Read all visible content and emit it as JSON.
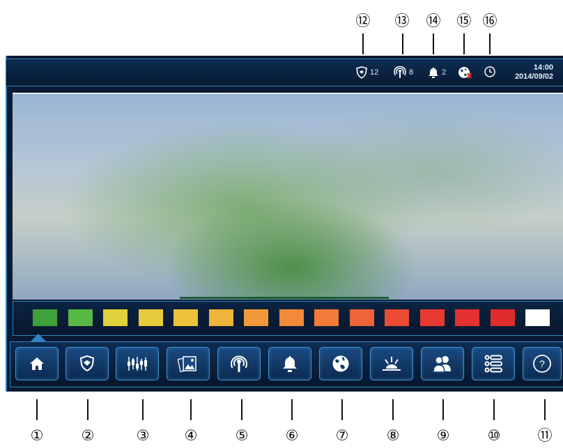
{
  "callouts_top": [
    "⑫",
    "⑬",
    "⑭",
    "⑮",
    "⑯"
  ],
  "callouts_bottom": [
    "①",
    "②",
    "③",
    "④",
    "⑤",
    "⑥",
    "⑦",
    "⑧",
    "⑨",
    "⑩",
    "⑪"
  ],
  "status": {
    "shield_count": "12",
    "antenna_count": "8",
    "bell_count": "2",
    "clock_time": "14:00",
    "clock_date": "2014/09/02"
  },
  "swatch_colors": [
    "#3fa13a",
    "#58b845",
    "#e0d23a",
    "#e6cc3c",
    "#ecc23a",
    "#efb43a",
    "#f29a3a",
    "#f28a3a",
    "#f27b3a",
    "#f0643a",
    "#ec4c36",
    "#e83a32",
    "#e33030",
    "#e02c2c",
    "#ffffff"
  ],
  "nav": [
    {
      "icon": "home-icon"
    },
    {
      "icon": "shield-icon"
    },
    {
      "icon": "chart-icon"
    },
    {
      "icon": "photos-icon"
    },
    {
      "icon": "antenna-icon"
    },
    {
      "icon": "bell-icon"
    },
    {
      "icon": "globe-icon"
    },
    {
      "icon": "sunrise-icon"
    },
    {
      "icon": "users-icon"
    },
    {
      "icon": "list-icon"
    },
    {
      "icon": "help-icon"
    }
  ],
  "help_label": "?"
}
